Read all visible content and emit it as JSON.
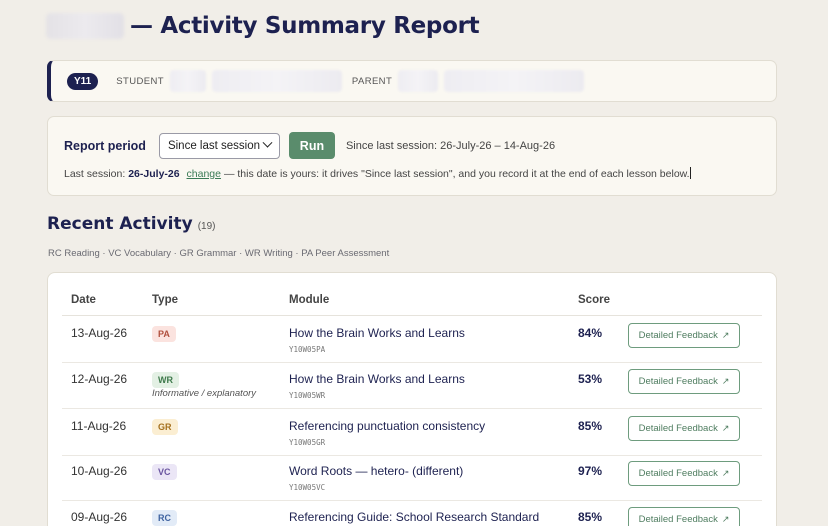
{
  "header": {
    "title": "— Activity Summary Report"
  },
  "student_card": {
    "year": "Y11",
    "student_label": "STUDENT",
    "parent_label": "PARENT"
  },
  "report": {
    "period_label": "Report period",
    "period_selected": "Since last session",
    "run_label": "Run",
    "range_text": "Since last session: 26-July-26 – 14-Aug-26",
    "last_session_prefix": "Last session:",
    "last_session_date": "26-July-26",
    "change_label": "change",
    "note": "— this date is yours: it drives \"Since last session\", and you record it at the end of each lesson below."
  },
  "activity": {
    "title": "Recent Activity",
    "count": "(19)",
    "legend": "RC Reading · VC Vocabulary · GR Grammar · WR Writing · PA Peer Assessment",
    "columns": {
      "date": "Date",
      "type": "Type",
      "module": "Module",
      "score": "Score"
    },
    "feedback_label": "Detailed Feedback",
    "feedback_icon": "external-arrow-icon",
    "rows": [
      {
        "date": "13-Aug-26",
        "type": "PA",
        "type_note": "",
        "module": "How the Brain Works and Learns",
        "code": "Y10W05PA",
        "score": "84%"
      },
      {
        "date": "12-Aug-26",
        "type": "WR",
        "type_note": "Informative / explanatory",
        "module": "How the Brain Works and Learns",
        "code": "Y10W05WR",
        "score": "53%"
      },
      {
        "date": "11-Aug-26",
        "type": "GR",
        "type_note": "",
        "module": "Referencing punctuation consistency",
        "code": "Y10W05GR",
        "score": "85%"
      },
      {
        "date": "10-Aug-26",
        "type": "VC",
        "type_note": "",
        "module": "Word Roots — hetero- (different)",
        "code": "Y10W05VC",
        "score": "97%"
      },
      {
        "date": "09-Aug-26",
        "type": "RC",
        "type_note": "",
        "module": "Referencing Guide: School Research Standard",
        "code": "",
        "score": "85%"
      }
    ]
  },
  "badge_colors": {
    "PA": {
      "bg": "#fbe3df",
      "fg": "#b0503e"
    },
    "WR": {
      "bg": "#e3f0e4",
      "fg": "#3f7a4c"
    },
    "GR": {
      "bg": "#fbeed2",
      "fg": "#a4701e"
    },
    "VC": {
      "bg": "#ebe6f6",
      "fg": "#6a55a0"
    },
    "RC": {
      "bg": "#e2ebf7",
      "fg": "#3f63a0"
    }
  }
}
